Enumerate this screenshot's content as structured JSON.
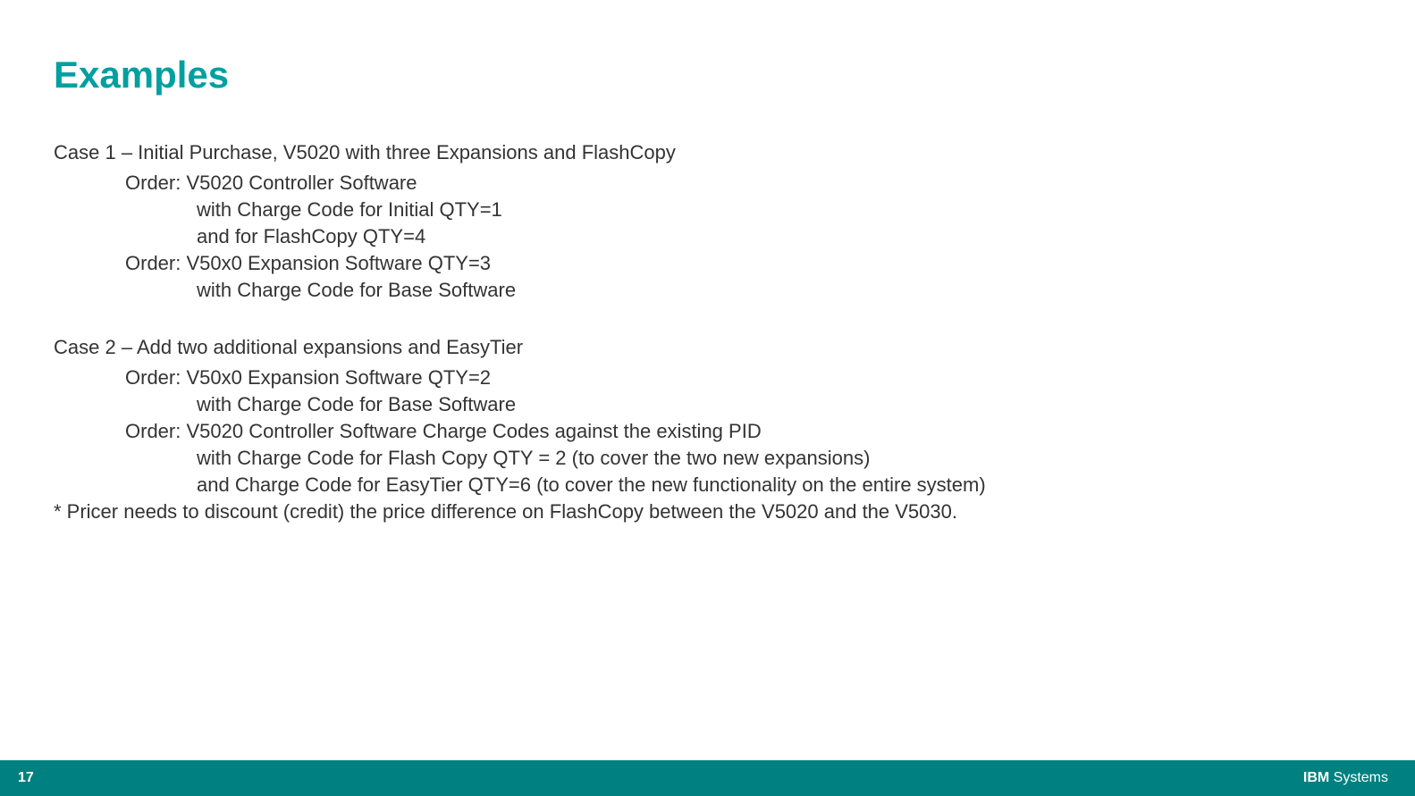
{
  "slide": {
    "title": "Examples",
    "cases": [
      {
        "heading": "Case 1 – Initial Purchase, V5020 with three Expansions and FlashCopy",
        "orders": [
          {
            "order_line": "Order: V5020 Controller Software",
            "details": [
              "with Charge Code for Initial QTY=1",
              "and for FlashCopy QTY=4"
            ]
          },
          {
            "order_line": "Order: V50x0 Expansion Software QTY=3",
            "details": [
              "with Charge Code for Base Software"
            ]
          }
        ]
      },
      {
        "heading": "Case 2 – Add two additional expansions and EasyTier",
        "orders": [
          {
            "order_line": "Order: V50x0 Expansion Software QTY=2",
            "details": [
              "with Charge Code for Base Software"
            ]
          },
          {
            "order_line": "Order:  V5020 Controller Software Charge Codes against the existing PID",
            "details": [
              "with Charge Code for Flash Copy QTY = 2 (to cover the two new expansions)",
              "and Charge Code for EasyTier QTY=6 (to cover the new functionality on the entire system)"
            ]
          }
        ],
        "note": "* Pricer needs to discount (credit) the price difference on FlashCopy between the V5020 and the V5030."
      }
    ],
    "footer": {
      "page_number": "17",
      "brand_ibm": "IBM",
      "brand_suffix": " Systems"
    }
  }
}
